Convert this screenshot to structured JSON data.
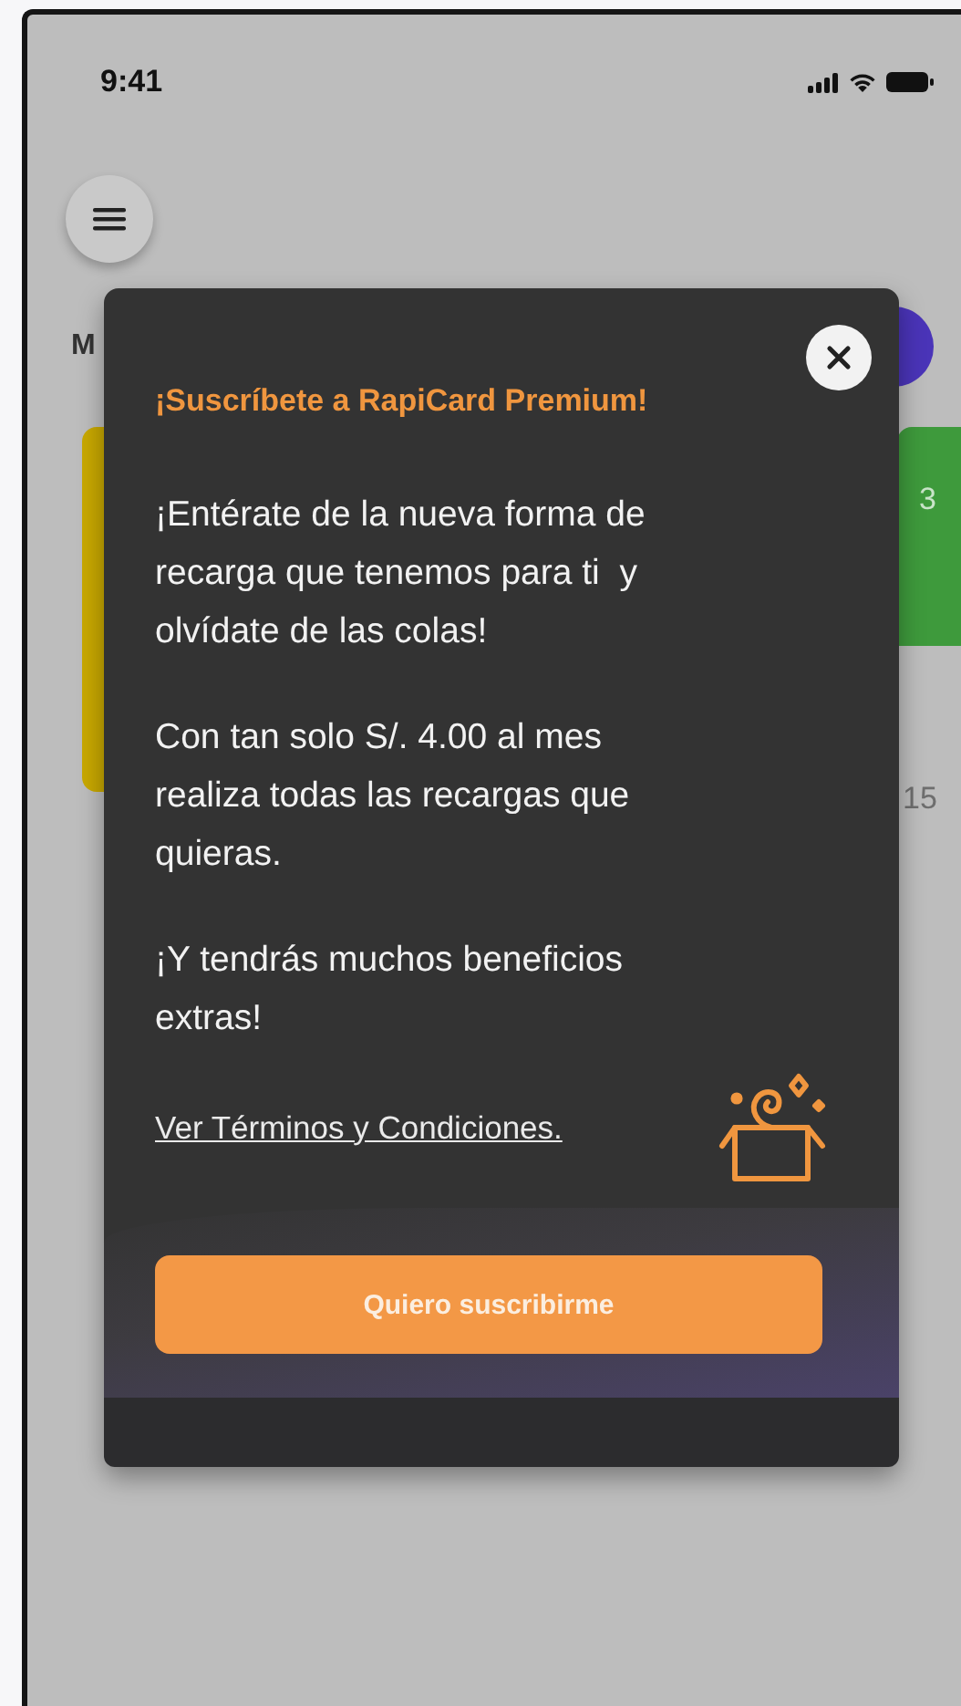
{
  "status_bar": {
    "time": "9:41"
  },
  "background": {
    "section_initial": "M",
    "card_number": "3",
    "card_amount": "15"
  },
  "modal": {
    "title": "¡Suscríbete a RapiCard Premium!",
    "paragraphs": [
      "¡Entérate de la nueva forma de recarga que tenemos para ti  y olvídate de las colas!",
      "Con tan solo S/. 4.00 al mes realiza todas las recargas que quieras.",
      "¡Y tendrás muchos beneficios extras!"
    ],
    "terms_link": "Ver Términos y Condiciones.",
    "button": "Quiero suscribirme"
  }
}
